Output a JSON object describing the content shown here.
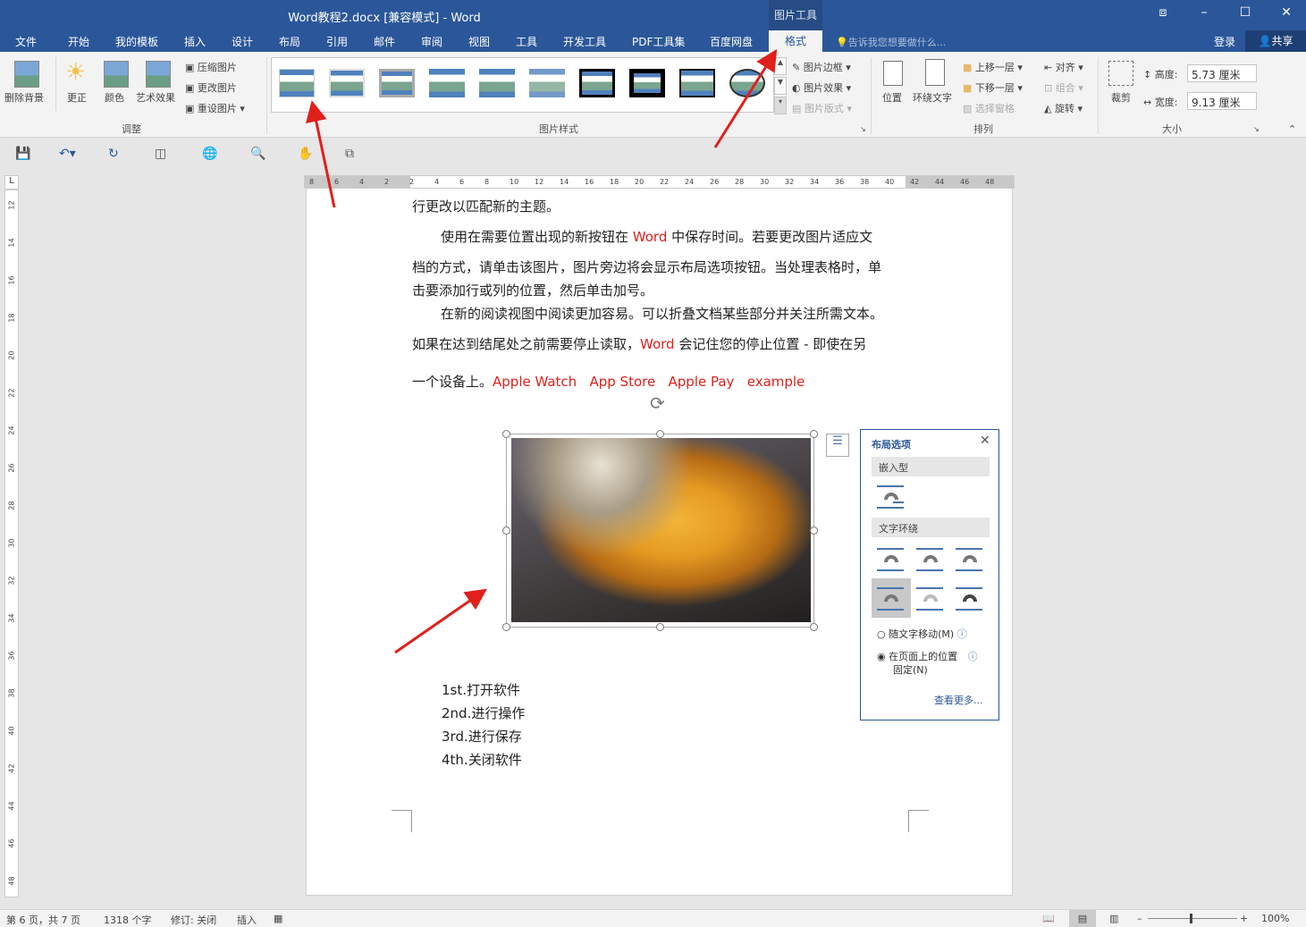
{
  "window": {
    "title": "Word教程2.docx [兼容模式] - Word",
    "context_group": "图片工具",
    "controls": {
      "restore_ribbon": "⧈",
      "minimize": "–",
      "maximize": "☐",
      "close": "✕"
    }
  },
  "tabs": [
    "文件",
    "开始",
    "我的模板",
    "插入",
    "设计",
    "布局",
    "引用",
    "邮件",
    "审阅",
    "视图",
    "工具",
    "开发工具",
    "PDF工具集",
    "百度网盘"
  ],
  "active_tab": "格式",
  "tell_me": "告诉我您想要做什么...",
  "login": "登录",
  "share": "共享",
  "ribbon": {
    "adjust": {
      "remove_bg": "删除背景",
      "corrections": "更正",
      "color": "颜色",
      "artistic": "艺术效果",
      "compress": "压缩图片",
      "change": "更改图片",
      "reset": "重设图片",
      "group": "调整"
    },
    "styles": {
      "border": "图片边框",
      "effects": "图片效果",
      "layout": "图片版式",
      "group": "图片样式"
    },
    "arrange": {
      "position": "位置",
      "wrap": "环绕文字",
      "forward": "上移一层",
      "backward": "下移一层",
      "pane": "选择窗格",
      "align": "对齐",
      "group_btn": "组合",
      "rotate": "旋转",
      "group": "排列"
    },
    "size": {
      "crop": "裁剪",
      "height_label": "高度:",
      "height": "5.73 厘米",
      "width_label": "宽度:",
      "width": "9.13 厘米",
      "group": "大小"
    }
  },
  "ruler": {
    "h": [
      "8",
      "6",
      "4",
      "2",
      "2",
      "4",
      "6",
      "8",
      "10",
      "12",
      "14",
      "16",
      "18",
      "20",
      "22",
      "24",
      "26",
      "28",
      "30",
      "32",
      "34",
      "36",
      "38",
      "40",
      "42",
      "44",
      "46",
      "48"
    ],
    "v": [
      "12",
      "14",
      "16",
      "18",
      "20",
      "22",
      "24",
      "26",
      "28",
      "30",
      "32",
      "34",
      "36",
      "38",
      "40",
      "42",
      "44",
      "46",
      "48"
    ]
  },
  "doc": {
    "l1": "行更改以匹配新的主题。",
    "l2a": "使用在需要位置出现的新按钮在 ",
    "l2b": "Word",
    "l2c": " 中保存时间。若要更改图片适应文",
    "l3": "档的方式，请单击该图片，图片旁边将会显示布局选项按钮。当处理表格时，单",
    "l4": "击要添加行或列的位置，然后单击加号。",
    "l5": "在新的阅读视图中阅读更加容易。可以折叠文档某些部分并关注所需文本。",
    "l6a": "如果在达到结尾处之前需要停止读取，",
    "l6b": "Word",
    "l6c": " 会记住您的停止位置 - 即使在另",
    "l7a": "一个设备上。",
    "l7b": "Apple Watch   App Store   Apple Pay   example",
    "list": [
      "1st.打开软件",
      "2nd.进行操作",
      "3rd.进行保存",
      "4th.关闭软件"
    ]
  },
  "layout_panel": {
    "title": "布局选项",
    "inline": "嵌入型",
    "wrap": "文字环绕",
    "move_with_text": "随文字移动(M)",
    "fix_position": "在页面上的位置",
    "fix_position2": "固定(N)",
    "see_more": "查看更多...",
    "selected_option": "fix_position"
  },
  "status": {
    "page": "第 6 页，共 7 页",
    "words": "1318 个字",
    "track": "修订: 关闭",
    "insert": "插入",
    "zoom": "100%"
  },
  "colors": {
    "brand": "#2b579a",
    "annotation_arrow": "#e0201b"
  }
}
